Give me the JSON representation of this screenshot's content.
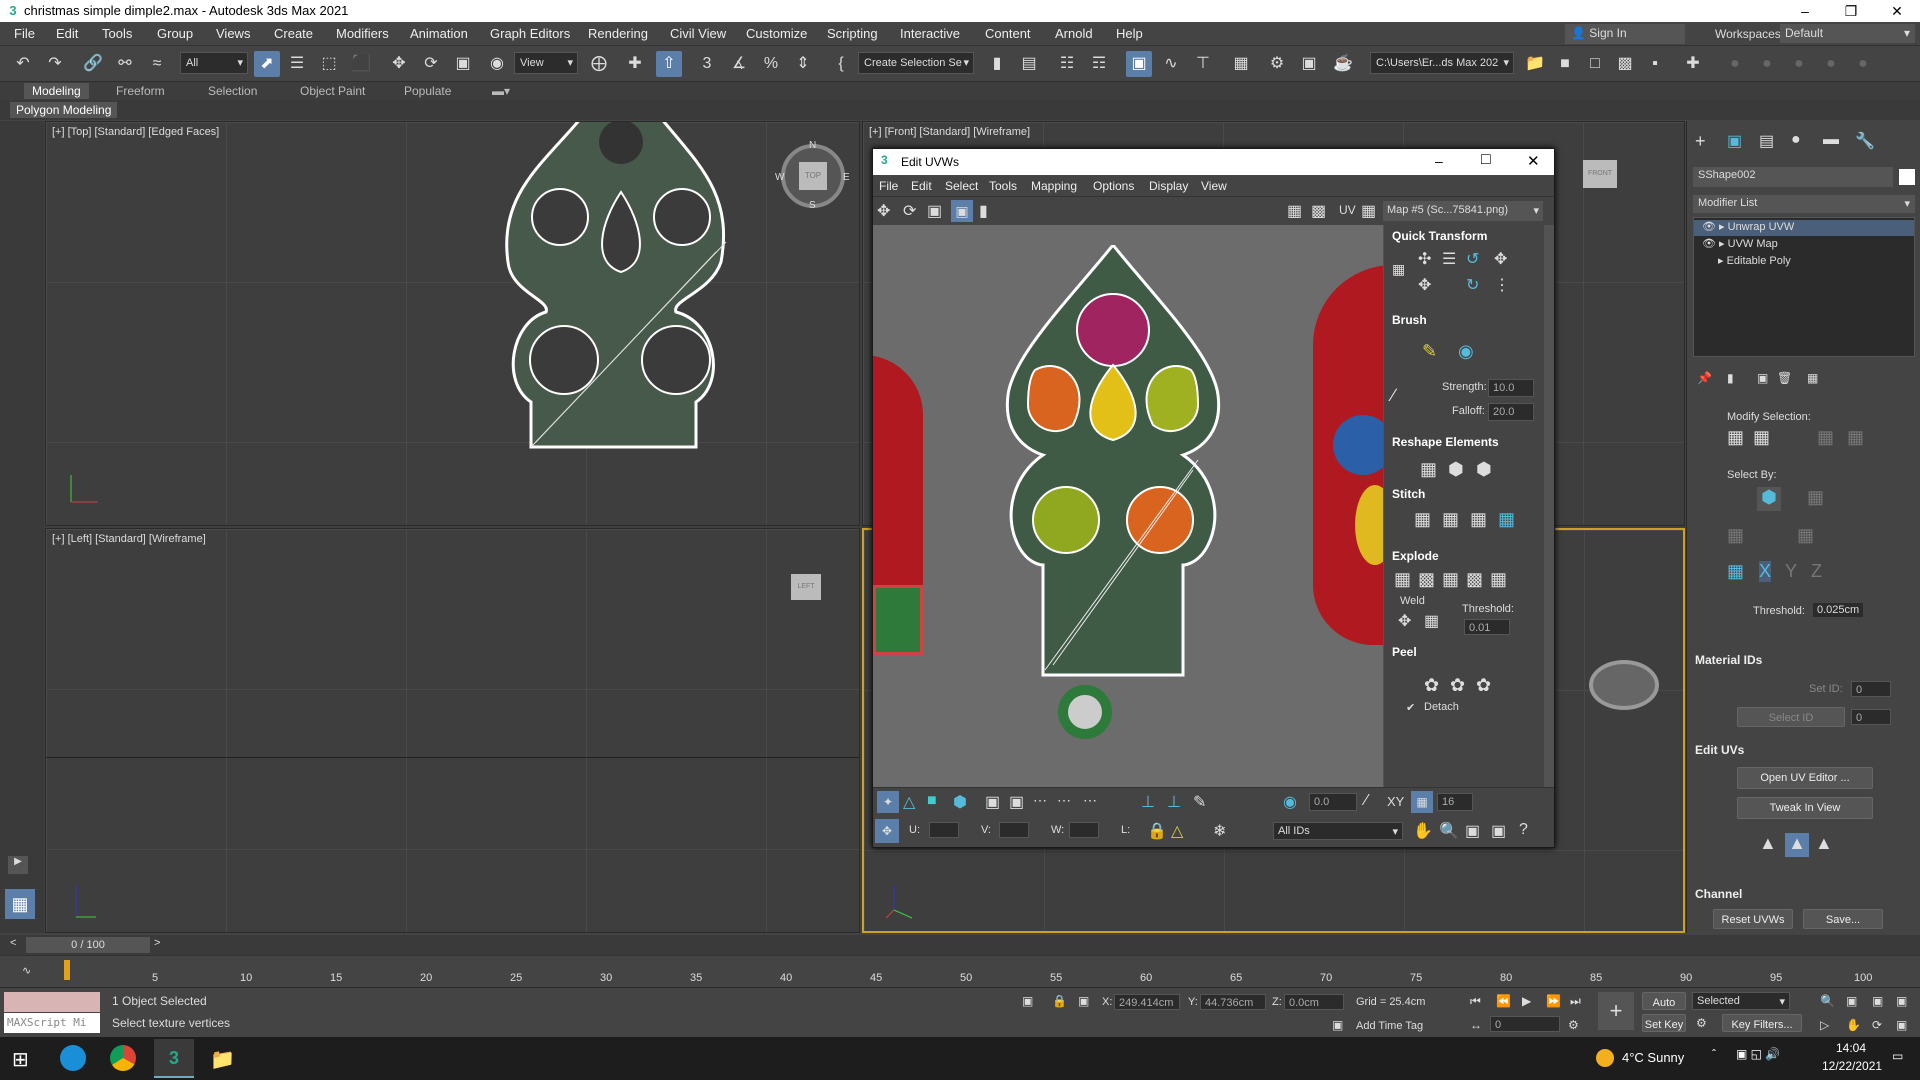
{
  "window": {
    "title": "christmas simple dimple2.max - Autodesk 3ds Max 2021"
  },
  "menubar": [
    "File",
    "Edit",
    "Tools",
    "Group",
    "Views",
    "Create",
    "Modifiers",
    "Animation",
    "Graph Editors",
    "Rendering",
    "Civil View",
    "Customize",
    "Scripting",
    "Interactive",
    "Content",
    "Arnold",
    "Help"
  ],
  "account": {
    "sign_in": "Sign In",
    "workspaces_label": "Workspaces:",
    "workspace": "Default"
  },
  "toolbar": {
    "filter": "All",
    "ref_coord": "View",
    "selection_set": "Create Selection Se",
    "project_path": "C:\\Users\\Er...ds Max 202"
  },
  "ribbon": {
    "tabs": [
      "Modeling",
      "Freeform",
      "Selection",
      "Object Paint",
      "Populate"
    ],
    "sub": "Polygon Modeling"
  },
  "viewports": {
    "top": "[+] [Top] [Standard] [Edged Faces]",
    "front": "[+] [Front] [Standard] [Wireframe]",
    "left": "[+] [Left] [Standard] [Wireframe]",
    "compass": {
      "n": "N",
      "s": "S",
      "e": "E",
      "w": "W",
      "top": "TOP"
    },
    "front_cube": "FRONT",
    "left_cube": "LEFT"
  },
  "uvw": {
    "title": "Edit UVWs",
    "menus": [
      "File",
      "Edit",
      "Select",
      "Tools",
      "Mapping",
      "Options",
      "Display",
      "View"
    ],
    "uv_label": "UV",
    "map": "Map #5 (Sc...75841.png)",
    "panels": {
      "quick_transform": "Quick Transform",
      "brush": "Brush",
      "strength_label": "Strength:",
      "strength": "10.0",
      "falloff_label": "Falloff:",
      "falloff": "20.0",
      "reshape": "Reshape Elements",
      "stitch": "Stitch",
      "explode": "Explode",
      "weld": "Weld",
      "threshold_label": "Threshold:",
      "threshold": "0.01",
      "peel": "Peel",
      "detach": "Detach"
    },
    "bottom": {
      "angle": "0.0",
      "xy": "XY",
      "grid": "16",
      "u": "U:",
      "v": "V:",
      "w": "W:",
      "l": "L:",
      "ids": "All IDs"
    }
  },
  "command_panel": {
    "object_name": "SShape002",
    "modifier_list": "Modifier List",
    "stack": [
      "Unwrap UVW",
      "UVW Map",
      "Editable Poly"
    ],
    "modify_selection": "Modify Selection:",
    "select_by": "Select By:",
    "threshold_label": "Threshold:",
    "threshold": "0.025cm",
    "material_ids": "Material IDs",
    "set_id": "Set ID:",
    "select_id": "Select ID",
    "id_val": "0",
    "edit_uvs": "Edit UVs",
    "open_uv_editor": "Open UV Editor ...",
    "tweak_in_view": "Tweak In View",
    "channel": "Channel",
    "reset_uvws": "Reset UVWs",
    "save": "Save..."
  },
  "timeline": {
    "frame": "0 / 100",
    "ticks": [
      "0",
      "5",
      "10",
      "15",
      "20",
      "25",
      "30",
      "35",
      "40",
      "45",
      "50",
      "55",
      "60",
      "65",
      "70",
      "75",
      "80",
      "85",
      "90",
      "95",
      "100"
    ]
  },
  "status": {
    "maxscript": "MAXScript Mi",
    "selected": "1 Object Selected",
    "prompt": "Select texture vertices",
    "x_label": "X:",
    "x": "249.414cm",
    "y_label": "Y:",
    "y": "44.736cm",
    "z_label": "Z:",
    "z": "0.0cm",
    "grid": "Grid = 25.4cm",
    "add_time_tag": "Add Time Tag",
    "auto_key": "Auto K...",
    "selected_mode": "Selected",
    "set_key": "Set Key",
    "key_filters": "Key Filters...",
    "frame_field": "0"
  },
  "taskbar": {
    "weather": "4°C  Sunny",
    "time": "14:04",
    "date": "12/22/2021"
  }
}
